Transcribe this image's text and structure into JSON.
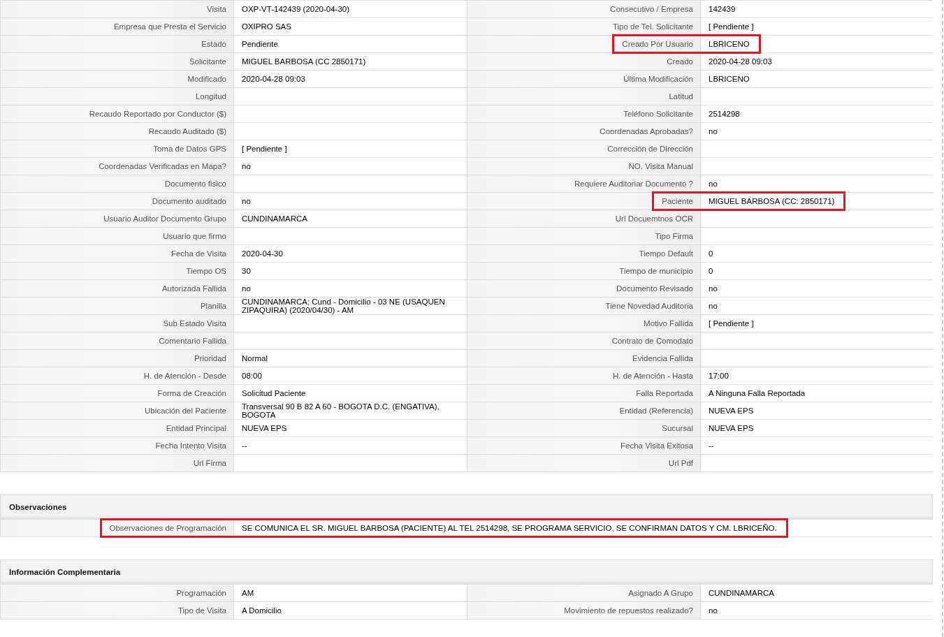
{
  "details": [
    {
      "left": {
        "label": "Visita",
        "value": "OXP-VT-142439 (2020-04-30)",
        "highlighted": false
      },
      "right": {
        "label": "Consecutivo / Empresa",
        "value": "142439",
        "highlighted": false
      }
    },
    {
      "left": {
        "label": "Empresa que Presta el Servicio",
        "value": "OXIPRO SAS",
        "highlighted": false
      },
      "right": {
        "label": "Tipo de Tel. Solicitante",
        "value": "[ Pendiente ]",
        "highlighted": false
      }
    },
    {
      "left": {
        "label": "Estado",
        "value": "Pendiente",
        "highlighted": false
      },
      "right": {
        "label": "Creado Por Usuario",
        "value": "LBRICENO",
        "highlighted": true
      }
    },
    {
      "left": {
        "label": "Solicitante",
        "value": "MIGUEL BARBOSA (CC 2850171)",
        "highlighted": false
      },
      "right": {
        "label": "Creado",
        "value": "2020-04-28 09:03",
        "highlighted": false
      }
    },
    {
      "left": {
        "label": "Modificado",
        "value": "2020-04-28 09:03",
        "highlighted": false
      },
      "right": {
        "label": "Última Modificación",
        "value": "LBRICENO",
        "highlighted": false
      }
    },
    {
      "left": {
        "label": "Longitud",
        "highlighted": false
      },
      "right": {
        "label": "Latitud",
        "highlighted": false
      }
    },
    {
      "left": {
        "label": "Recaudo Reportado por Conductor ($)",
        "highlighted": false
      },
      "right": {
        "label": "Teléfono Solicitante",
        "value": "2514298",
        "highlighted": false
      }
    },
    {
      "left": {
        "label": "Recaudo Auditado ($)",
        "highlighted": false
      },
      "right": {
        "label": "Coordenadas Aprobadas?",
        "value": "no",
        "highlighted": false
      }
    },
    {
      "left": {
        "label": "Toma de Datos GPS",
        "value": "[ Pendiente ]",
        "highlighted": false
      },
      "right": {
        "label": "Corrección de Dirección",
        "highlighted": false
      }
    },
    {
      "left": {
        "label": "Coordenadas Verificadas en Mapa?",
        "value": "no",
        "highlighted": false
      },
      "right": {
        "label": "NO. Visita Manual",
        "highlighted": false
      }
    },
    {
      "left": {
        "label": "Documento fisico",
        "highlighted": false
      },
      "right": {
        "label": "Requiere Auditoriar Documento ?",
        "value": "no",
        "highlighted": false
      }
    },
    {
      "left": {
        "label": "Documento auditado",
        "value": "no",
        "highlighted": false
      },
      "right": {
        "label": "Paciente",
        "value": "MIGUEL BARBOSA (CC: 2850171)",
        "highlighted": true
      }
    },
    {
      "left": {
        "label": "Usuario Auditor Documento Grupo",
        "value": "CUNDINAMARCA",
        "highlighted": false
      },
      "right": {
        "label": "Url Docuemtnos OCR",
        "highlighted": false
      }
    },
    {
      "left": {
        "label": "Usuario que firmo",
        "highlighted": false
      },
      "right": {
        "label": "Tipo Firma",
        "highlighted": false
      }
    },
    {
      "left": {
        "label": "Fecha de Visita",
        "value": "2020-04-30",
        "highlighted": false
      },
      "right": {
        "label": "Tiempo Default",
        "value": "0",
        "highlighted": false
      }
    },
    {
      "left": {
        "label": "Tiempo OS",
        "value": "30",
        "highlighted": false
      },
      "right": {
        "label": "Tiempo de municipio",
        "value": "0",
        "highlighted": false
      }
    },
    {
      "left": {
        "label": "Autorizada Fallida",
        "value": "no",
        "highlighted": false
      },
      "right": {
        "label": "Documento Revisado",
        "value": "no",
        "highlighted": false
      }
    },
    {
      "left": {
        "label": "Planilla",
        "value": "CUNDINAMARCA: Cund - Domicilio - 03 NE (USAQUEN ZIPAQUIRA) (2020/04/30) - AM",
        "highlighted": false
      },
      "right": {
        "label": "Tiene Novedad Auditoria",
        "value": "no",
        "highlighted": false
      }
    },
    {
      "left": {
        "label": "Sub Estado Visita",
        "highlighted": false
      },
      "right": {
        "label": "Motivo Fallida",
        "value": "[ Pendiente ]",
        "highlighted": false
      }
    },
    {
      "left": {
        "label": "Comentario Fallida",
        "highlighted": false
      },
      "right": {
        "label": "Contrato de Comodato",
        "highlighted": false
      }
    },
    {
      "left": {
        "label": "Prioridad",
        "value": "Normal",
        "highlighted": false
      },
      "right": {
        "label": "Evidencia Fallida",
        "highlighted": false
      }
    },
    {
      "left": {
        "label": "H. de Atención - Desde",
        "value": "08:00",
        "highlighted": false
      },
      "right": {
        "label": "H. de Atención - Hasta",
        "value": "17:00",
        "highlighted": false
      }
    },
    {
      "left": {
        "label": "Forma de Creación",
        "value": "Solicitud Paciente",
        "highlighted": false
      },
      "right": {
        "label": "Falla Reportada",
        "value": "A Ninguna Falla Reportada",
        "highlighted": false
      }
    },
    {
      "left": {
        "label": "Ubicación del Paciente",
        "value": "Transversal 90 B 82 A 60 - BOGOTA D.C. (ENGATIVA), BOGOTA",
        "highlighted": false
      },
      "right": {
        "label": "Entidad (Referencia)",
        "value": "NUEVA EPS",
        "highlighted": false
      }
    },
    {
      "left": {
        "label": "Entidad Principal",
        "value": "NUEVA EPS",
        "highlighted": false
      },
      "right": {
        "label": "Sucursal",
        "value": "NUEVA EPS",
        "highlighted": false
      }
    },
    {
      "left": {
        "label": "Fecha Intento Visita",
        "value": "--",
        "highlighted": false
      },
      "right": {
        "label": "Fecha Visita Exitosa",
        "value": "--",
        "highlighted": false
      }
    },
    {
      "left": {
        "label": "Url Firma",
        "highlighted": false
      },
      "right": {
        "label": "Url Pdf",
        "highlighted": false
      }
    }
  ],
  "observaciones": {
    "title": "Observaciones",
    "label": "Observaciones de Programación",
    "value": "SE COMUNICA EL SR. MIGUEL BARBOSA (PACIENTE) AL TEL 2514298, SE PROGRAMA SERVICIO, SE CONFIRMAN DATOS Y CM. LBRICEÑO.",
    "highlighted": true
  },
  "complementaria": {
    "title": "Información Complementaria",
    "rows": [
      {
        "left": {
          "label": "Programación",
          "value": "AM",
          "highlighted": false
        },
        "right": {
          "label": "Asignado A Grupo",
          "value": "CUNDINAMARCA",
          "highlighted": false
        }
      },
      {
        "left": {
          "label": "Tipo de Visita",
          "value": "A Domicilio",
          "highlighted": false
        },
        "right": {
          "label": "Movimiento de repuestos realizado?",
          "value": "no",
          "highlighted": false
        }
      }
    ]
  }
}
